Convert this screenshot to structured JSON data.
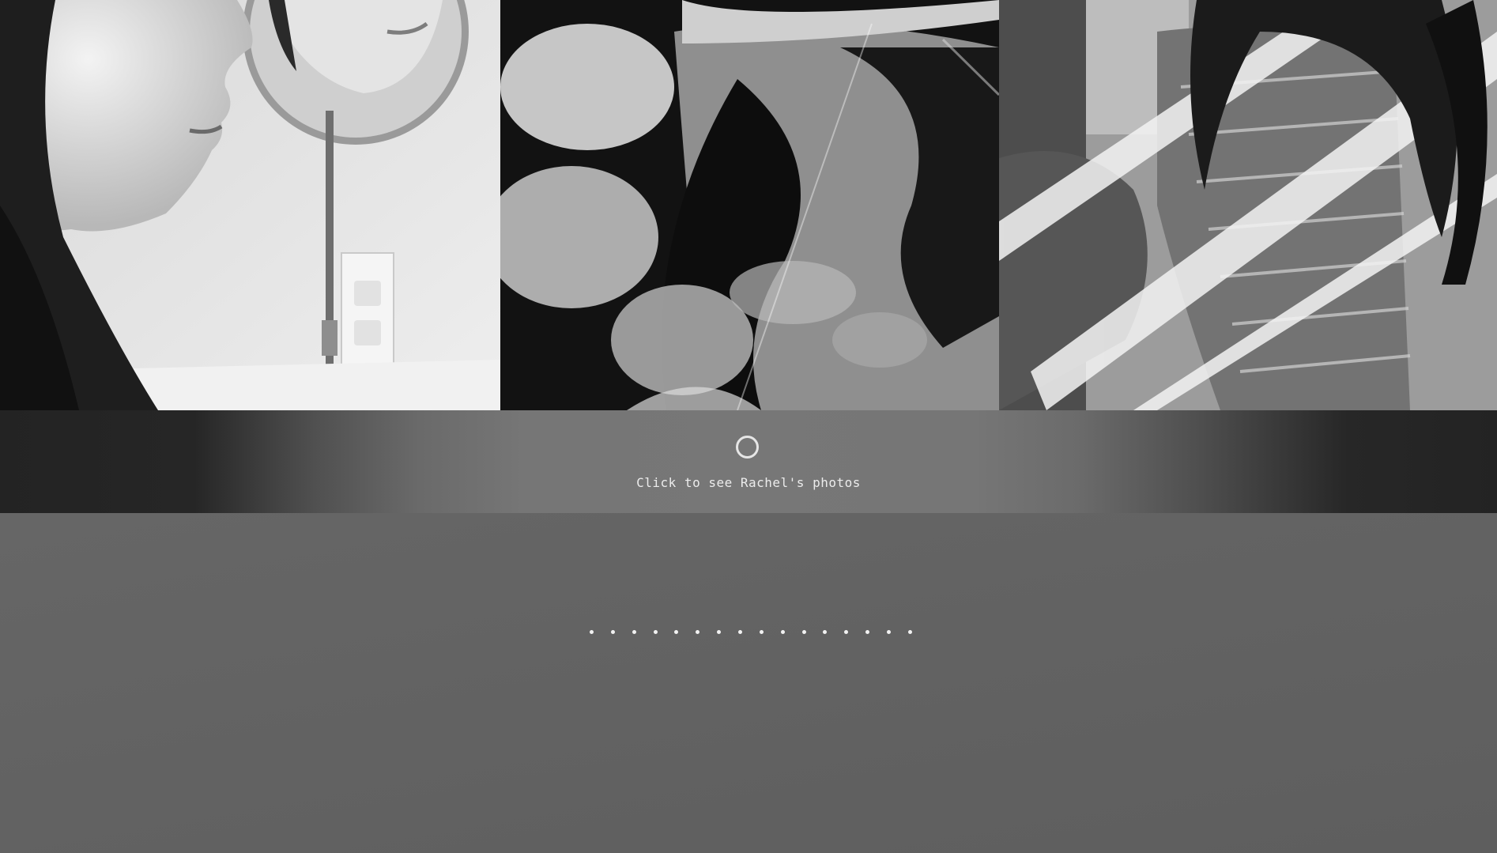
{
  "gallery": {
    "photos": [
      {
        "subject": "woman-with-hand-mirror"
      },
      {
        "subject": "plant-shadows-on-shirt"
      },
      {
        "subject": "woman-in-striped-shirt-sunlight"
      }
    ]
  },
  "banner": {
    "icon": "circle-ring-icon",
    "label": "Click to see Rachel's photos"
  },
  "pagination": {
    "dot_count": 16
  }
}
